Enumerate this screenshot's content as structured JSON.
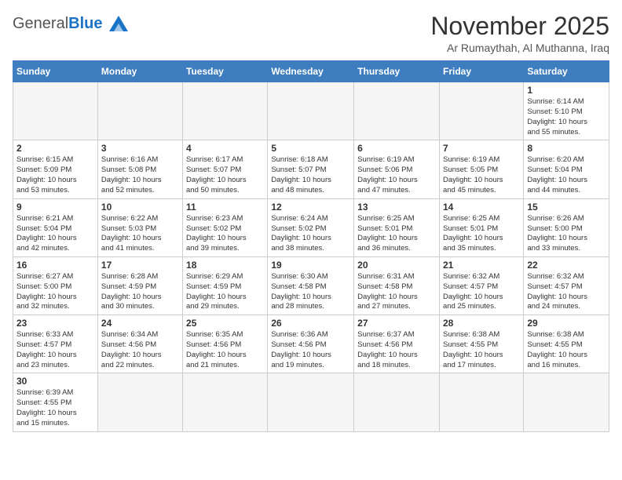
{
  "logo": {
    "general": "General",
    "blue": "Blue"
  },
  "title": "November 2025",
  "subtitle": "Ar Rumaythah, Al Muthanna, Iraq",
  "days_of_week": [
    "Sunday",
    "Monday",
    "Tuesday",
    "Wednesday",
    "Thursday",
    "Friday",
    "Saturday"
  ],
  "weeks": [
    [
      {
        "day": "",
        "info": ""
      },
      {
        "day": "",
        "info": ""
      },
      {
        "day": "",
        "info": ""
      },
      {
        "day": "",
        "info": ""
      },
      {
        "day": "",
        "info": ""
      },
      {
        "day": "",
        "info": ""
      },
      {
        "day": "1",
        "info": "Sunrise: 6:14 AM\nSunset: 5:10 PM\nDaylight: 10 hours\nand 55 minutes."
      }
    ],
    [
      {
        "day": "2",
        "info": "Sunrise: 6:15 AM\nSunset: 5:09 PM\nDaylight: 10 hours\nand 53 minutes."
      },
      {
        "day": "3",
        "info": "Sunrise: 6:16 AM\nSunset: 5:08 PM\nDaylight: 10 hours\nand 52 minutes."
      },
      {
        "day": "4",
        "info": "Sunrise: 6:17 AM\nSunset: 5:07 PM\nDaylight: 10 hours\nand 50 minutes."
      },
      {
        "day": "5",
        "info": "Sunrise: 6:18 AM\nSunset: 5:07 PM\nDaylight: 10 hours\nand 48 minutes."
      },
      {
        "day": "6",
        "info": "Sunrise: 6:19 AM\nSunset: 5:06 PM\nDaylight: 10 hours\nand 47 minutes."
      },
      {
        "day": "7",
        "info": "Sunrise: 6:19 AM\nSunset: 5:05 PM\nDaylight: 10 hours\nand 45 minutes."
      },
      {
        "day": "8",
        "info": "Sunrise: 6:20 AM\nSunset: 5:04 PM\nDaylight: 10 hours\nand 44 minutes."
      }
    ],
    [
      {
        "day": "9",
        "info": "Sunrise: 6:21 AM\nSunset: 5:04 PM\nDaylight: 10 hours\nand 42 minutes."
      },
      {
        "day": "10",
        "info": "Sunrise: 6:22 AM\nSunset: 5:03 PM\nDaylight: 10 hours\nand 41 minutes."
      },
      {
        "day": "11",
        "info": "Sunrise: 6:23 AM\nSunset: 5:02 PM\nDaylight: 10 hours\nand 39 minutes."
      },
      {
        "day": "12",
        "info": "Sunrise: 6:24 AM\nSunset: 5:02 PM\nDaylight: 10 hours\nand 38 minutes."
      },
      {
        "day": "13",
        "info": "Sunrise: 6:25 AM\nSunset: 5:01 PM\nDaylight: 10 hours\nand 36 minutes."
      },
      {
        "day": "14",
        "info": "Sunrise: 6:25 AM\nSunset: 5:01 PM\nDaylight: 10 hours\nand 35 minutes."
      },
      {
        "day": "15",
        "info": "Sunrise: 6:26 AM\nSunset: 5:00 PM\nDaylight: 10 hours\nand 33 minutes."
      }
    ],
    [
      {
        "day": "16",
        "info": "Sunrise: 6:27 AM\nSunset: 5:00 PM\nDaylight: 10 hours\nand 32 minutes."
      },
      {
        "day": "17",
        "info": "Sunrise: 6:28 AM\nSunset: 4:59 PM\nDaylight: 10 hours\nand 30 minutes."
      },
      {
        "day": "18",
        "info": "Sunrise: 6:29 AM\nSunset: 4:59 PM\nDaylight: 10 hours\nand 29 minutes."
      },
      {
        "day": "19",
        "info": "Sunrise: 6:30 AM\nSunset: 4:58 PM\nDaylight: 10 hours\nand 28 minutes."
      },
      {
        "day": "20",
        "info": "Sunrise: 6:31 AM\nSunset: 4:58 PM\nDaylight: 10 hours\nand 27 minutes."
      },
      {
        "day": "21",
        "info": "Sunrise: 6:32 AM\nSunset: 4:57 PM\nDaylight: 10 hours\nand 25 minutes."
      },
      {
        "day": "22",
        "info": "Sunrise: 6:32 AM\nSunset: 4:57 PM\nDaylight: 10 hours\nand 24 minutes."
      }
    ],
    [
      {
        "day": "23",
        "info": "Sunrise: 6:33 AM\nSunset: 4:57 PM\nDaylight: 10 hours\nand 23 minutes."
      },
      {
        "day": "24",
        "info": "Sunrise: 6:34 AM\nSunset: 4:56 PM\nDaylight: 10 hours\nand 22 minutes."
      },
      {
        "day": "25",
        "info": "Sunrise: 6:35 AM\nSunset: 4:56 PM\nDaylight: 10 hours\nand 21 minutes."
      },
      {
        "day": "26",
        "info": "Sunrise: 6:36 AM\nSunset: 4:56 PM\nDaylight: 10 hours\nand 19 minutes."
      },
      {
        "day": "27",
        "info": "Sunrise: 6:37 AM\nSunset: 4:56 PM\nDaylight: 10 hours\nand 18 minutes."
      },
      {
        "day": "28",
        "info": "Sunrise: 6:38 AM\nSunset: 4:55 PM\nDaylight: 10 hours\nand 17 minutes."
      },
      {
        "day": "29",
        "info": "Sunrise: 6:38 AM\nSunset: 4:55 PM\nDaylight: 10 hours\nand 16 minutes."
      }
    ],
    [
      {
        "day": "30",
        "info": "Sunrise: 6:39 AM\nSunset: 4:55 PM\nDaylight: 10 hours\nand 15 minutes."
      },
      {
        "day": "",
        "info": ""
      },
      {
        "day": "",
        "info": ""
      },
      {
        "day": "",
        "info": ""
      },
      {
        "day": "",
        "info": ""
      },
      {
        "day": "",
        "info": ""
      },
      {
        "day": "",
        "info": ""
      }
    ]
  ]
}
